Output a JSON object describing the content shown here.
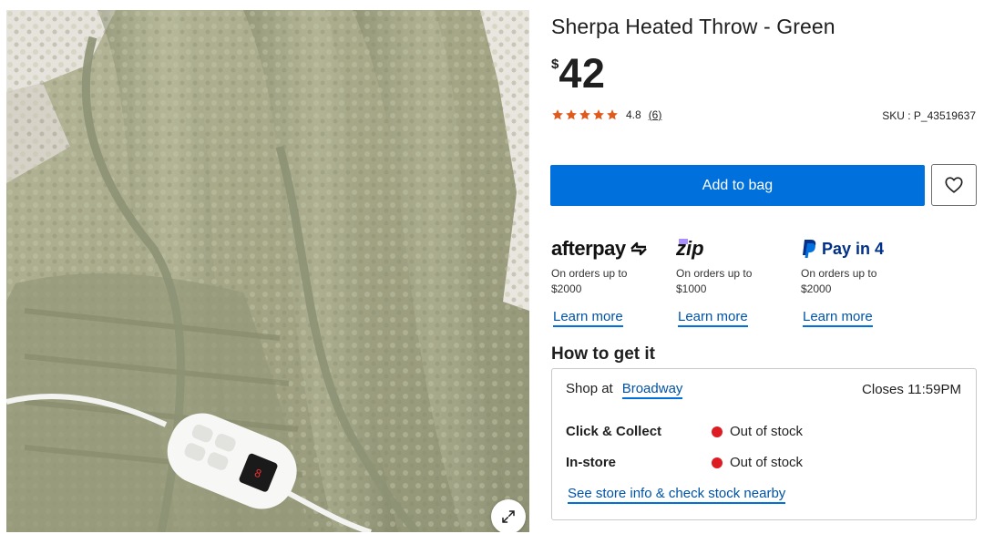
{
  "product": {
    "title": "Sherpa Heated Throw - Green",
    "currency_symbol": "$",
    "price": "42",
    "rating_value": 4.8,
    "rating_text": "4.8",
    "review_count": "(6)",
    "sku": "SKU : P_43519637"
  },
  "actions": {
    "add_to_bag_label": "Add to bag",
    "wishlist_icon": "heart-icon",
    "expand_icon": "expand-icon"
  },
  "payments": [
    {
      "brand": "afterpay",
      "desc_line1": "On orders up to",
      "desc_line2": "$2000",
      "link": "Learn more"
    },
    {
      "brand": "zip",
      "desc_line1": "On orders up to",
      "desc_line2": "$1000",
      "link": "Learn more"
    },
    {
      "brand": "Pay in 4",
      "desc_line1": "On orders up to",
      "desc_line2": "$2000",
      "link": "Learn more"
    }
  ],
  "fulfilment": {
    "heading": "How to get it",
    "shop_at_label": "Shop at",
    "store_name": "Broadway",
    "closes": "Closes 11:59PM",
    "rows": [
      {
        "label": "Click & Collect",
        "status": "Out of stock"
      },
      {
        "label": "In-store",
        "status": "Out of stock"
      }
    ],
    "store_info_link": "See store info & check stock nearby"
  },
  "colors": {
    "primary_blue": "#0071dc",
    "link_blue": "#0053a7",
    "star_orange": "#e05a1e",
    "out_of_stock_red": "#de1c24"
  }
}
